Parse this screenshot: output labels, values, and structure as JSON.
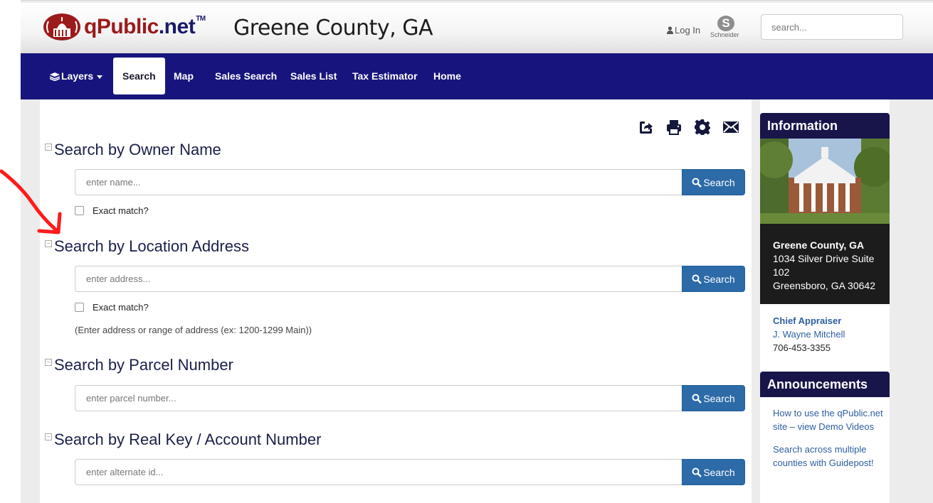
{
  "header": {
    "logo_main": "qPublic",
    "logo_suffix": ".net",
    "logo_tm": "TM",
    "county_title": "Greene County, GA",
    "login_label": "Log In",
    "brand_partner": "Schneider",
    "search_placeholder": "search..."
  },
  "nav": {
    "items": [
      {
        "label": "Layers",
        "active": false,
        "has_caret": true
      },
      {
        "label": "Search",
        "active": true
      },
      {
        "label": "Map",
        "active": false
      },
      {
        "label": "Sales Search",
        "active": false
      },
      {
        "label": "Sales List",
        "active": false
      },
      {
        "label": "Tax Estimator",
        "active": false
      },
      {
        "label": "Home",
        "active": false
      }
    ]
  },
  "toolbar": {
    "icons": [
      "share-icon",
      "print-icon",
      "settings-icon",
      "email-icon"
    ]
  },
  "sections": [
    {
      "title": "Search by Owner Name",
      "placeholder": "enter name...",
      "button": "Search",
      "exact_label": "Exact match?"
    },
    {
      "title": "Search by Location Address",
      "placeholder": "enter address...",
      "button": "Search",
      "exact_label": "Exact match?",
      "hint": "(Enter address or range of address (ex: 1200-1299 Main))"
    },
    {
      "title": "Search by Parcel Number",
      "placeholder": "enter parcel number...",
      "button": "Search"
    },
    {
      "title": "Search by Real Key / Account Number",
      "placeholder": "enter alternate id...",
      "button": "Search"
    }
  ],
  "sidebar": {
    "info_title": "Information",
    "office_name": "Greene County, GA",
    "address_line1": "1034 Silver Drive Suite",
    "address_line2": "102",
    "address_line3": "Greensboro, GA 30642",
    "appraiser_title": "Chief Appraiser",
    "appraiser_name": "J. Wayne Mitchell",
    "phone": "706-453-3355",
    "announcements_title": "Announcements",
    "announcement_1_line1": "How to use the qPublic.net",
    "announcement_1_line2": "site – view Demo Videos",
    "announcement_2_line1": "Search across multiple",
    "announcement_2_line2": "counties with Guidepost!"
  },
  "colors": {
    "nav_bg": "#17157d",
    "button_bg": "#2c6aa8",
    "heading": "#1a1f4a",
    "sidebar_head": "#17154a",
    "annotation_arrow": "#ff0000"
  }
}
